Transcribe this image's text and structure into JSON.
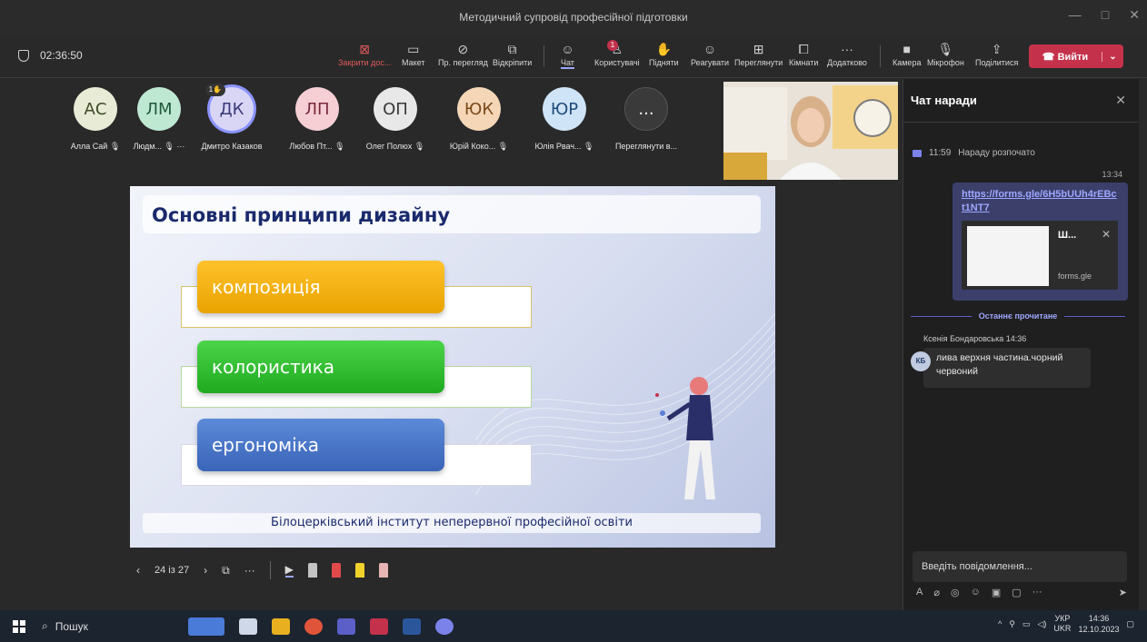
{
  "window": {
    "title": "Методичний супровід професійної підготовки"
  },
  "toolbar": {
    "timer": "02:36:50",
    "buttons": [
      {
        "label": "Закрити дос...",
        "icon": "stop-share-icon"
      },
      {
        "label": "Макет",
        "icon": "layout-icon"
      },
      {
        "label": "Пр. перегляд",
        "icon": "hide-preview-icon"
      },
      {
        "label": "Відкріпити",
        "icon": "popout-icon"
      },
      {
        "label": "Чат",
        "icon": "chat-icon"
      },
      {
        "label": "Користувачі",
        "icon": "people-icon",
        "badge": "1"
      },
      {
        "label": "Підняти",
        "icon": "raise-hand-icon"
      },
      {
        "label": "Реагувати",
        "icon": "react-icon"
      },
      {
        "label": "Переглянути",
        "icon": "view-icon"
      },
      {
        "label": "Кімнати",
        "icon": "rooms-icon"
      },
      {
        "label": "Додатково",
        "icon": "more-icon"
      },
      {
        "label": "Камера",
        "icon": "camera-icon"
      },
      {
        "label": "Мікрофон",
        "icon": "mic-icon"
      },
      {
        "label": "Поділитися",
        "icon": "share-icon"
      }
    ],
    "leave_label": "Вийти"
  },
  "participants": [
    {
      "initials": "АС",
      "name": "Алла Сай",
      "color": "#e8ecd6"
    },
    {
      "initials": "ЛМ",
      "name": "Людм...",
      "color": "#bfe8d3"
    },
    {
      "initials": "ДК",
      "name": "Дмитро Казаков",
      "color": "#d9d6f5",
      "hand": "1"
    },
    {
      "initials": "ЛП",
      "name": "Любов Пт...",
      "color": "#f5cfd4"
    },
    {
      "initials": "ОП",
      "name": "Олег Полюх",
      "color": "#e8e8e8"
    },
    {
      "initials": "ЮК",
      "name": "Юрій Коко...",
      "color": "#f5d7b8"
    },
    {
      "initials": "ЮР",
      "name": "Юлія Рвач...",
      "color": "#cfe4f7"
    },
    {
      "initials": "...",
      "name": "Переглянути в...",
      "color": "#3a3a3a"
    }
  ],
  "slide": {
    "title": "Основні принципи дизайну",
    "items": [
      "композиція",
      "колористика",
      "ергономіка"
    ],
    "footer": "Білоцерківський інститут неперервної професійної освіти"
  },
  "slide_controls": {
    "page": "24 із 27"
  },
  "chat": {
    "title": "Чат наради",
    "system_time": "11:59",
    "system_text": "Нараду розпочато",
    "msg_time": "13:34",
    "link": "https://forms.gle/6H5bUUh4rEBct1NT7",
    "preview_title": "Ш...",
    "preview_domain": "forms.gle",
    "last_read": "Останнє прочитане",
    "sender": "Ксенія Бондаровська",
    "sender_time": "14:36",
    "sender_initials": "КБ",
    "message": "лива верхня частина.чорний червоний",
    "compose_placeholder": "Введіть повідомлення..."
  },
  "taskbar": {
    "search": "Пошук",
    "lang_top": "УКР",
    "lang_bottom": "UKR",
    "time": "14:36",
    "date": "12.10.2023"
  }
}
